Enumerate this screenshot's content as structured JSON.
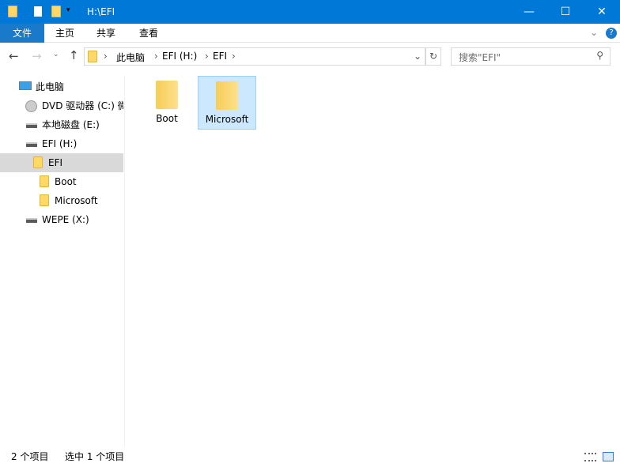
{
  "title": "H:\\EFI",
  "ribbon": {
    "tabs": [
      "文件",
      "主页",
      "共享",
      "查看"
    ]
  },
  "breadcrumb": [
    "此电脑",
    "EFI (H:)",
    "EFI"
  ],
  "search": {
    "placeholder": "搜索\"EFI\""
  },
  "tree": [
    {
      "label": "此电脑",
      "icon": "computer-icon"
    },
    {
      "label": "DVD 驱动器 (C:) 微",
      "icon": "dvd-icon"
    },
    {
      "label": "本地磁盘 (E:)",
      "icon": "drive-icon"
    },
    {
      "label": "EFI (H:)",
      "icon": "drive-icon"
    },
    {
      "label": "EFI",
      "icon": "folder-icon"
    },
    {
      "label": "Boot",
      "icon": "folder-icon"
    },
    {
      "label": "Microsoft",
      "icon": "folder-icon"
    },
    {
      "label": "WEPE (X:)",
      "icon": "drive-icon"
    }
  ],
  "items": [
    {
      "name": "Boot"
    },
    {
      "name": "Microsoft"
    }
  ],
  "status": {
    "count": "2 个项目",
    "selected": "选中 1 个项目"
  },
  "colors": {
    "accent": "#0078d7",
    "selection": "#cce8ff",
    "tree_selected": "#d9d9d9"
  }
}
